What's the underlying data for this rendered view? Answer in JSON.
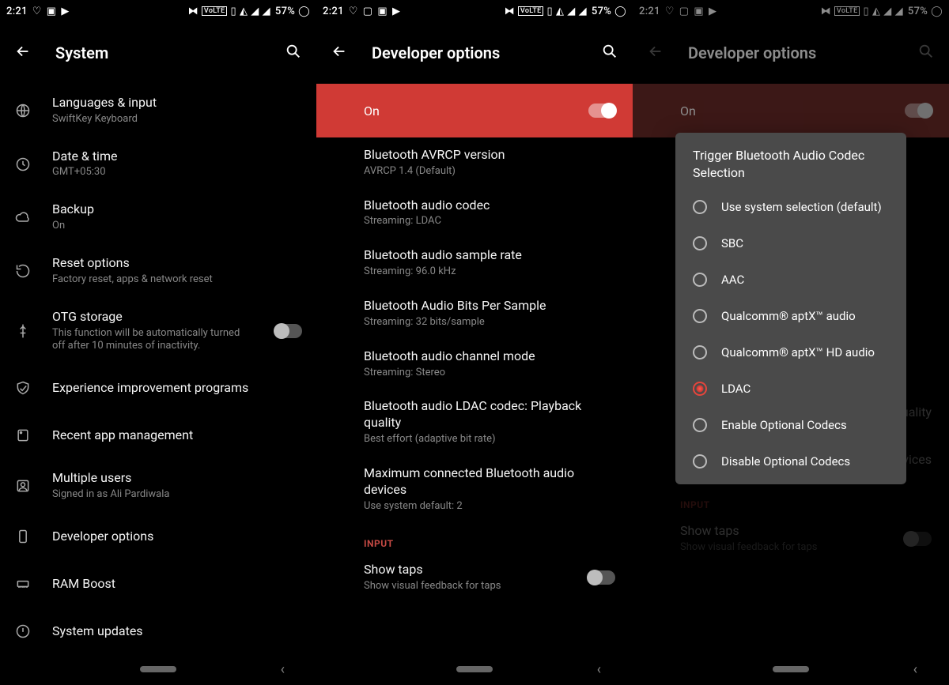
{
  "status": {
    "time": "2:21",
    "volte": "VoLTE",
    "battery": "57%"
  },
  "screen1": {
    "title": "System",
    "items": [
      {
        "icon": "globe",
        "title": "Languages & input",
        "sub": "SwiftKey Keyboard"
      },
      {
        "icon": "clock",
        "title": "Date & time",
        "sub": "GMT+05:30"
      },
      {
        "icon": "cloud",
        "title": "Backup",
        "sub": "On"
      },
      {
        "icon": "reset",
        "title": "Reset options",
        "sub": "Factory reset, apps & network reset"
      },
      {
        "icon": "usb",
        "title": "OTG storage",
        "sub": "This function will be automatically turned off after 10 minutes of inactivity.",
        "toggle": true
      },
      {
        "icon": "shield",
        "title": "Experience improvement programs",
        "sub": ""
      },
      {
        "icon": "lock-app",
        "title": "Recent app management",
        "sub": ""
      },
      {
        "icon": "users",
        "title": "Multiple users",
        "sub": "Signed in as Ali Pardiwala"
      },
      {
        "icon": "phone",
        "title": "Developer options",
        "sub": ""
      },
      {
        "icon": "ram",
        "title": "RAM Boost",
        "sub": ""
      },
      {
        "icon": "update",
        "title": "System updates",
        "sub": ""
      }
    ]
  },
  "screen2": {
    "title": "Developer options",
    "on_label": "On",
    "items": [
      {
        "title": "Bluetooth AVRCP version",
        "sub": "AVRCP 1.4 (Default)"
      },
      {
        "title": "Bluetooth audio codec",
        "sub": "Streaming: LDAC"
      },
      {
        "title": "Bluetooth audio sample rate",
        "sub": "Streaming: 96.0 kHz"
      },
      {
        "title": "Bluetooth Audio Bits Per Sample",
        "sub": "Streaming: 32 bits/sample"
      },
      {
        "title": "Bluetooth audio channel mode",
        "sub": "Streaming: Stereo"
      },
      {
        "title": "Bluetooth audio LDAC codec: Playback quality",
        "sub": "Best effort (adaptive bit rate)"
      },
      {
        "title": "Maximum connected Bluetooth audio devices",
        "sub": "Use system default: 2"
      }
    ],
    "section": "INPUT",
    "show_taps": {
      "title": "Show taps",
      "sub": "Show visual feedback for taps"
    }
  },
  "screen3": {
    "title": "Developer options",
    "on_label": "On",
    "bg_peek": [
      {
        "title": "quality",
        "sub": ""
      },
      {
        "title": "vices",
        "sub": ""
      }
    ],
    "section": "INPUT",
    "show_taps": {
      "title": "Show taps",
      "sub": "Show visual feedback for taps"
    },
    "dialog": {
      "title": "Trigger Bluetooth Audio Codec Selection",
      "options": [
        {
          "label": "Use system selection (default)",
          "selected": false
        },
        {
          "label": "SBC",
          "selected": false
        },
        {
          "label": "AAC",
          "selected": false
        },
        {
          "label": "Qualcomm® aptX™ audio",
          "selected": false
        },
        {
          "label": "Qualcomm® aptX™ HD audio",
          "selected": false
        },
        {
          "label": "LDAC",
          "selected": true
        },
        {
          "label": "Enable Optional Codecs",
          "selected": false
        },
        {
          "label": "Disable Optional Codecs",
          "selected": false
        }
      ]
    }
  }
}
